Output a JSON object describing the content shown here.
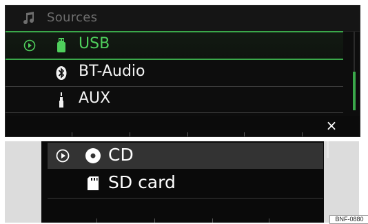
{
  "top_screen": {
    "header": {
      "title": "Sources",
      "icon": "music-note-icon"
    },
    "items": [
      {
        "label": "USB",
        "source_icon": "usb-icon",
        "selected": true
      },
      {
        "label": "BT-Audio",
        "source_icon": "bluetooth-icon",
        "selected": false
      },
      {
        "label": "AUX",
        "source_icon": "aux-plug-icon",
        "selected": false
      }
    ],
    "close_label": "×",
    "colors": {
      "accent": "#3aa84a",
      "active_text": "#4fcf5c",
      "background": "#0d0d0d",
      "header_text": "#6e6e6e"
    }
  },
  "bottom_screen": {
    "items": [
      {
        "label": "CD",
        "source_icon": "disc-icon",
        "selected": true
      },
      {
        "label": "SD card",
        "source_icon": "sd-card-icon",
        "selected": false
      }
    ]
  },
  "figure_code": "BNF-0880"
}
